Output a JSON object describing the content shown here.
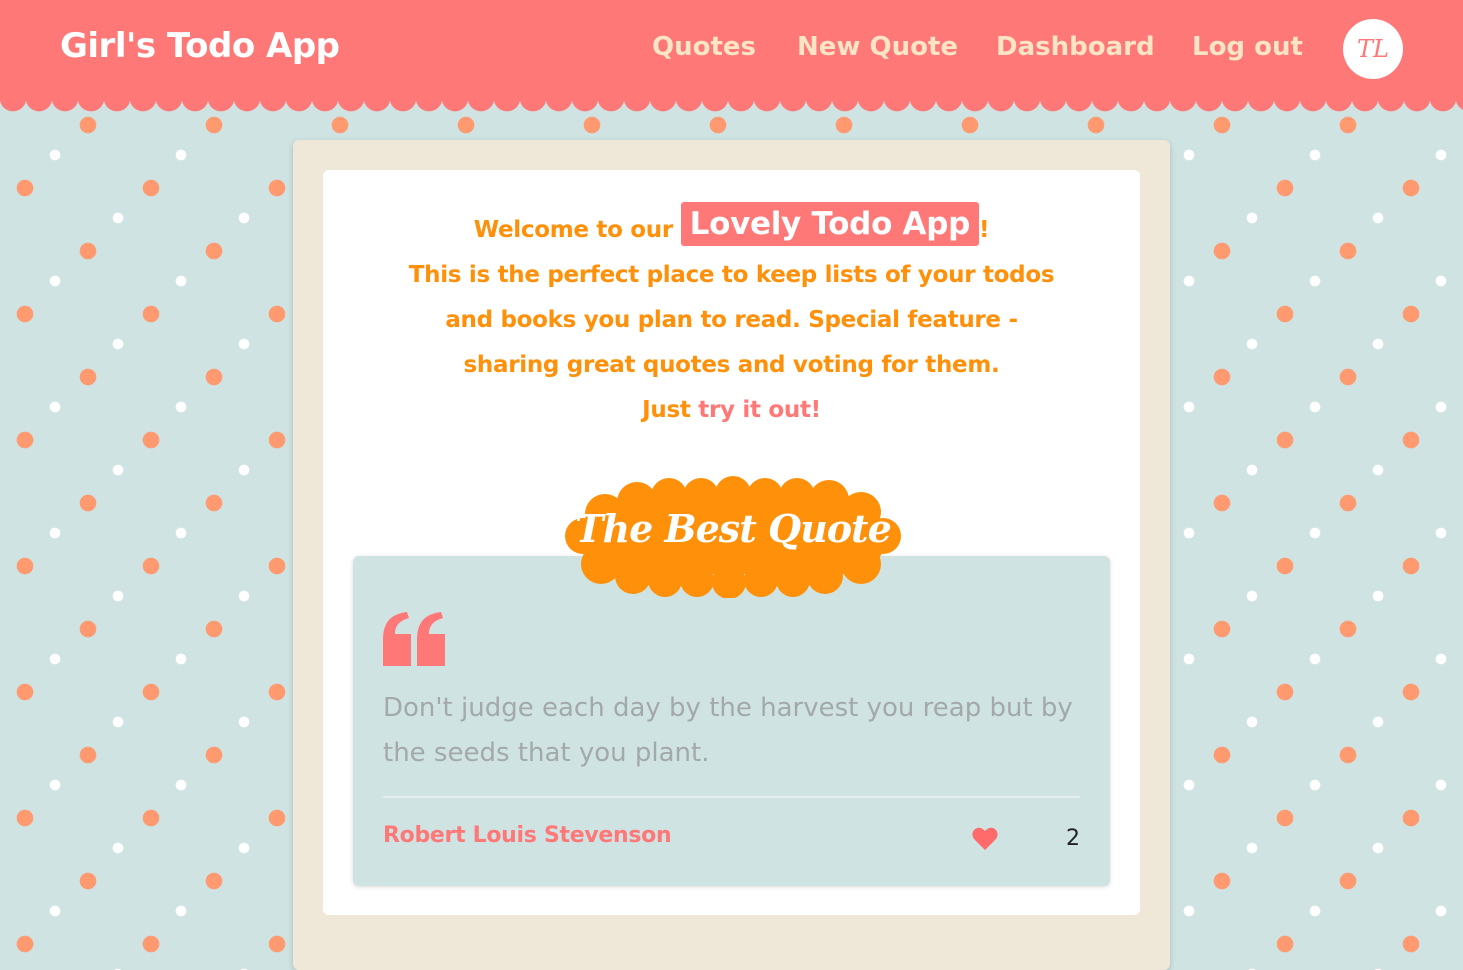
{
  "navbar": {
    "brand": "Girl's Todo App",
    "links": [
      "Quotes",
      "New Quote",
      "Dashboard",
      "Log out"
    ],
    "avatar_initials": "TL"
  },
  "intro": {
    "welcome_prefix": "Welcome to our",
    "app_name": "Lovely Todo App",
    "welcome_suffix": "!",
    "line2": "This is the perfect place to keep lists of your todos",
    "line3": "and books you plan to read. Special feature -",
    "line4": "sharing great quotes and voting for them.",
    "line5_prefix": "Just",
    "try_link": "try it out!"
  },
  "best_quote": {
    "badge_title": "The Best Quote",
    "text": "Don't judge each day by the harvest you reap but by the seeds that you plant.",
    "author": "Robert Louis Stevenson",
    "likes": "2"
  },
  "colors": {
    "navbar": "#ff7878",
    "nav_text": "#fde4c4",
    "accent_orange": "#ff900a",
    "background": "#cfe3e3",
    "dot_orange": "#ff9a70",
    "card_frame": "#efe8d8"
  },
  "icons": [
    "quote-mark-icon",
    "heart-icon"
  ]
}
